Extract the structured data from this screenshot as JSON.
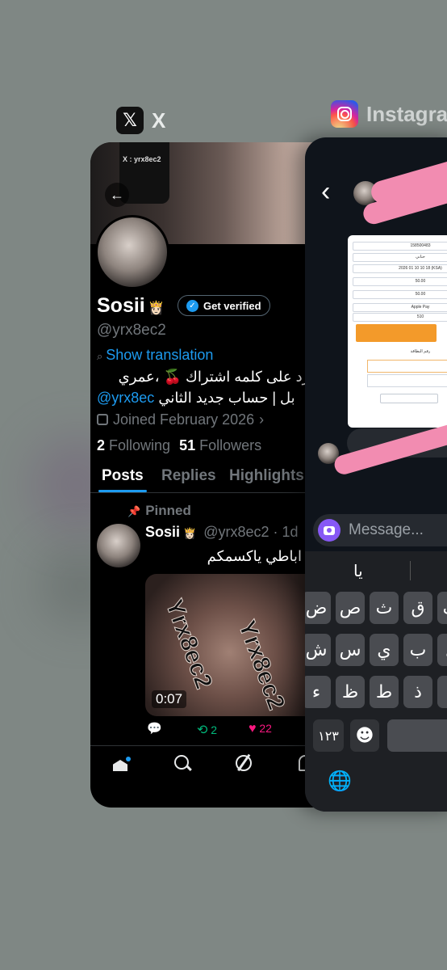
{
  "switcher": {
    "x_app_name": "X",
    "x_icon_glyph": "𝕏",
    "instagram_app_name": "Instagra"
  },
  "x_profile": {
    "phone_case_text": "X : yrx8ec2",
    "back_glyph": "←",
    "display_name": "Sosii",
    "crown_emoji": "👸🏻",
    "get_verified_label": "Get verified",
    "handle": "@yrx8ec2",
    "translate_glyph": "⌕",
    "show_translation": "Show translation",
    "bio_line1": "ين ارد على كلمه اشتراك 🍒 ،عمري",
    "bio_line2_mention": "@yrx8ec",
    "bio_line2_text": "بل | حساب جديد الثاني",
    "joined": "Joined February 2026",
    "following_count": "2",
    "following_label": "Following",
    "followers_count": "51",
    "followers_label": "Followers",
    "tabs": [
      "Posts",
      "Replies",
      "Highlights"
    ],
    "active_tab": "Posts",
    "pinned_label": "Pinned",
    "post": {
      "name": "Sosii",
      "crown": "👸🏻",
      "handle_time": "@yrx8ec2 · 1d",
      "text": "يشم اباطي ياكسمكم",
      "video_duration": "0:07",
      "watermark": "Yrx8ec2",
      "reposts": "2",
      "likes": "22"
    },
    "colors": {
      "accent": "#1d9bf0",
      "repost": "#00ba7c",
      "like": "#f91880"
    }
  },
  "instagram": {
    "back_glyph": "‹",
    "message_placeholder": "Message...",
    "suggestion": "يا",
    "shot_rows": [
      "158500483",
      "حناني",
      "2026 01 10 10 18 (KSA)",
      "50.00",
      "50.00",
      "Apple Pay",
      "510",
      "رقم البطاقة"
    ],
    "keyboard_rows": [
      [
        "ف",
        "ق",
        "ث",
        "ص",
        "ض"
      ],
      [
        "ل",
        "ب",
        "ي",
        "س",
        "ش"
      ],
      [
        "د",
        "ذ",
        "ط",
        "ظ",
        "ء"
      ]
    ],
    "numbers_key": "١٢٣",
    "globe_icon": "🌐",
    "emoji_icon": "☻"
  }
}
